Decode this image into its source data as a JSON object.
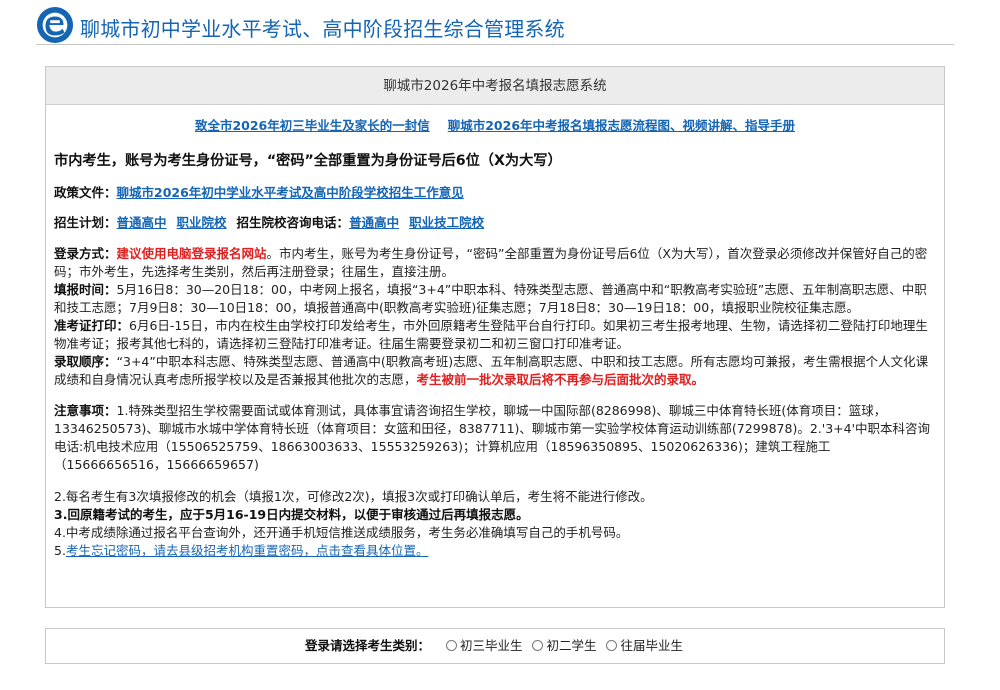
{
  "header": {
    "title": "聊城市初中学业水平考试、高中阶段招生综合管理系统",
    "logo_icon": "e-logo-icon"
  },
  "panel": {
    "title": "聊城市2026年中考报名填报志愿系统",
    "links": [
      "致全市2026年初三毕业生及家长的一封信",
      "聊城市2026年中考报名填报志愿流程图、视频讲解、指导手册"
    ],
    "notice": "市内考生，账号为考生身份证号，“密码”全部重置为身份证号后6位（X为大写）",
    "policy": {
      "label": "政策文件：",
      "link": "聊城市2026年初中学业水平考试及高中阶段学校招生工作意见"
    },
    "plan": {
      "label": "招生计划：",
      "link1": "普通高中",
      "link2": "职业院校",
      "consult_label": "招生院校咨询电话：",
      "link3": "普通高中",
      "link4": "职业技工院校"
    },
    "login": {
      "label": "登录方式：",
      "red": "建议使用电脑登录报名网站",
      "text": "。市内考生，账号为考生身份证号，“密码”全部重置为身份证号后6位（X为大写），首次登录必须修改并保管好自己的密码；市外考生，先选择考生类别，然后再注册登录；往届生，直接注册。"
    },
    "fill": {
      "label": "填报时间：",
      "text": "5月16日8：30—20日18：00，中考网上报名，填报“3+4”中职本科、特殊类型志愿、普通高中和“职教高考实验班”志愿、五年制高职志愿、中职和技工志愿；7月9日8：30—10日18：00，填报普通高中(职教高考实验班)征集志愿；7月18日8：30—19日18：00，填报职业院校征集志愿。"
    },
    "ticket": {
      "label": "准考证打印：",
      "text": "6月6日-15日，市内在校生由学校打印发给考生，市外回原籍考生登陆平台自行打印。如果初三考生报考地理、生物，请选择初二登陆打印地理生物准考证；报考其他七科的，请选择初三登陆打印准考证。往届生需要登录初二和初三窗口打印准考证。"
    },
    "order": {
      "label": "录取顺序：",
      "text": "“3+4”中职本科志愿、特殊类型志愿、普通高中(职教高考班)志愿、五年制高职志愿、中职和技工志愿。所有志愿均可兼报，考生需根据个人文化课成绩和自身情况认真考虑所报学校以及是否兼报其他批次的志愿，",
      "red": "考生被前一批次录取后将不再参与后面批次的录取。"
    },
    "note": {
      "label": "注意事项：",
      "text": "1.特殊类型招生学校需要面试或体育测试，具体事宜请咨询招生学校，聊城一中国际部(8286998)、聊城三中体育特长班(体育项目：篮球，13346250573)、聊城市水城中学体育特长班（体育项目：女篮和田径，8387711)、聊城市第一实验学校体育运动训练部(7299878)。2.'3+4'中职本科咨询电话:机电技术应用（15506525759、18663003633、15553259263)；计算机应用（18596350895、15020626336)；建筑工程施工（15666656516，15666659657)"
    },
    "items": {
      "i2": "2.每名考生有3次填报修改的机会（填报1次，可修改2次)，填报3次或打印确认单后，考生将不能进行修改。",
      "i3": "3.回原籍考试的考生，应于5月16-19日内提交材料，以便于审核通过后再填报志愿。",
      "i4": "4.中考成绩除通过报名平台查询外，还开通手机短信推送成绩服务，考生务必准确填写自己的手机号码。",
      "i5_prefix": "5.",
      "i5_link": "考生忘记密码，请去县级招考机构重置密码，点击查看具体位置。"
    }
  },
  "login_panel": {
    "label": "登录请选择考生类别：",
    "options": [
      "初三毕业生",
      "初二学生",
      "往届毕业生"
    ]
  }
}
